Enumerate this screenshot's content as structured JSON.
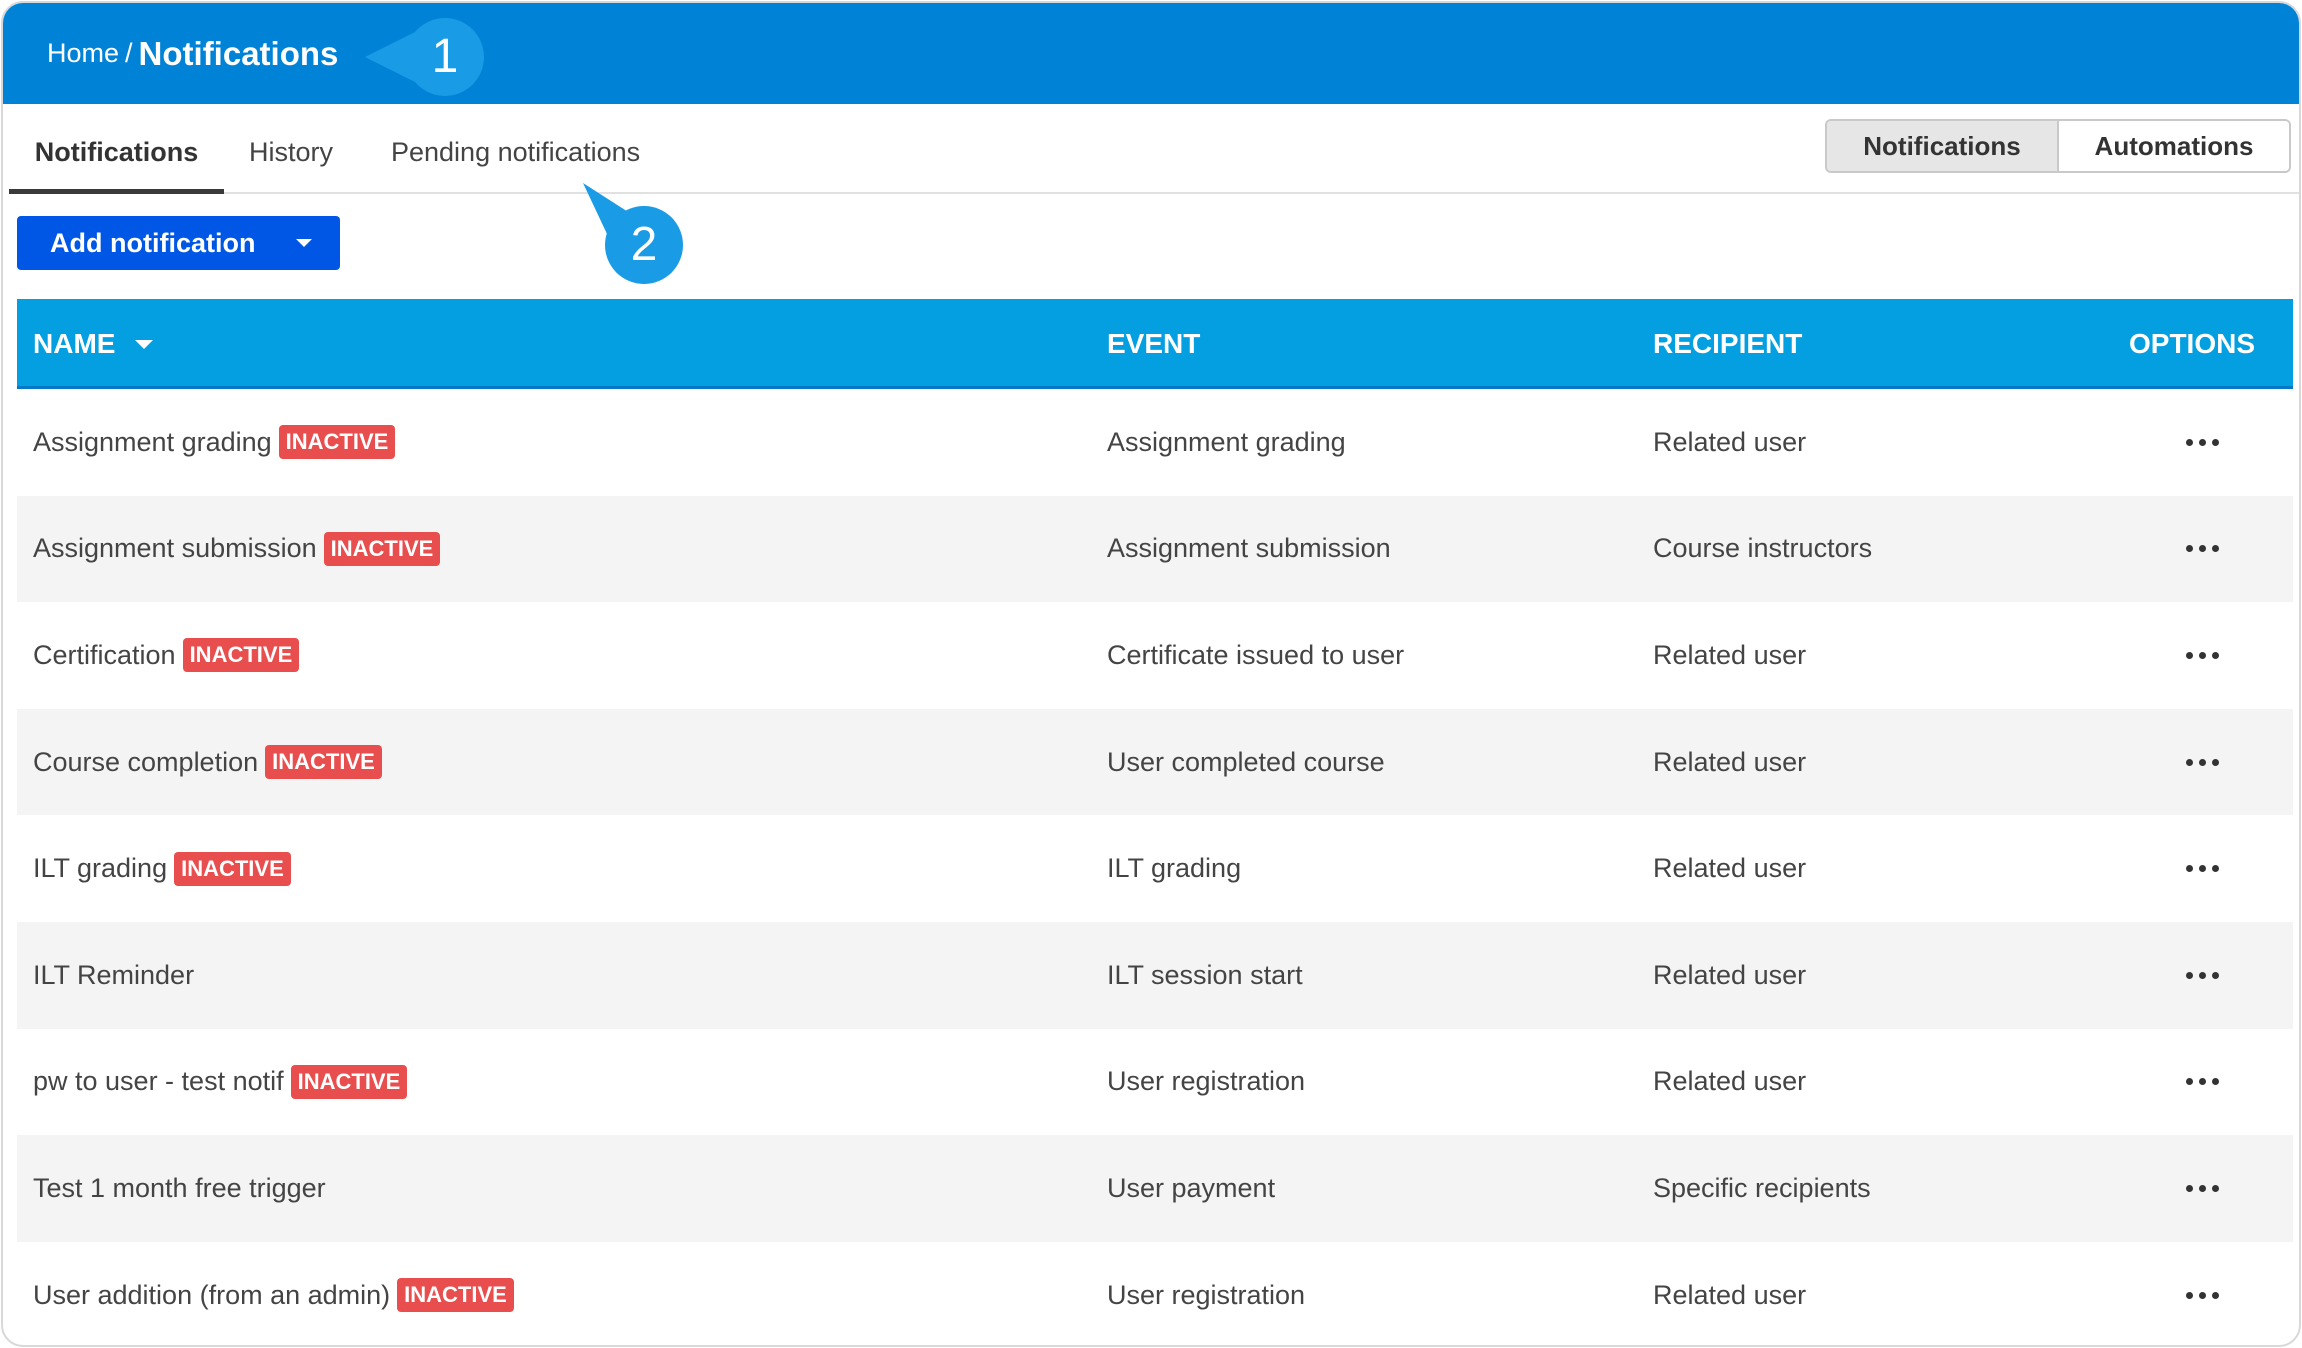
{
  "breadcrumb": {
    "home": "Home",
    "separator": "/",
    "current": "Notifications"
  },
  "callouts": [
    "1",
    "2"
  ],
  "tabs": [
    {
      "label": "Notifications",
      "active": true
    },
    {
      "label": "History",
      "active": false
    },
    {
      "label": "Pending notifications",
      "active": false
    }
  ],
  "view_toggle": {
    "notifications": "Notifications",
    "automations": "Automations",
    "selected": "Notifications"
  },
  "add_button": {
    "label": "Add notification"
  },
  "table": {
    "columns": {
      "name": "NAME",
      "event": "EVENT",
      "recipient": "RECIPIENT",
      "options": "OPTIONS"
    },
    "rows": [
      {
        "name": "Assignment grading",
        "status": "INACTIVE",
        "event": "Assignment grading",
        "recipient": "Related user"
      },
      {
        "name": "Assignment submission",
        "status": "INACTIVE",
        "event": "Assignment submission",
        "recipient": "Course instructors"
      },
      {
        "name": "Certification",
        "status": "INACTIVE",
        "event": "Certificate issued to user",
        "recipient": "Related user"
      },
      {
        "name": "Course completion",
        "status": "INACTIVE",
        "event": "User completed course",
        "recipient": "Related user"
      },
      {
        "name": "ILT grading",
        "status": "INACTIVE",
        "event": "ILT grading",
        "recipient": "Related user"
      },
      {
        "name": "ILT Reminder",
        "status": "",
        "event": "ILT session start",
        "recipient": "Related user"
      },
      {
        "name": "pw to user - test notif",
        "status": "INACTIVE",
        "event": "User registration",
        "recipient": "Related user"
      },
      {
        "name": "Test 1 month free trigger",
        "status": "",
        "event": "User payment",
        "recipient": "Specific recipients"
      },
      {
        "name": "User addition (from an admin)",
        "status": "INACTIVE",
        "event": "User registration",
        "recipient": "Related user"
      }
    ]
  },
  "colors": {
    "header": "#0083d6",
    "table_header": "#049fe0",
    "primary_button": "#0057e6",
    "inactive_badge": "#e84e4e",
    "callout": "#1a9be6"
  }
}
